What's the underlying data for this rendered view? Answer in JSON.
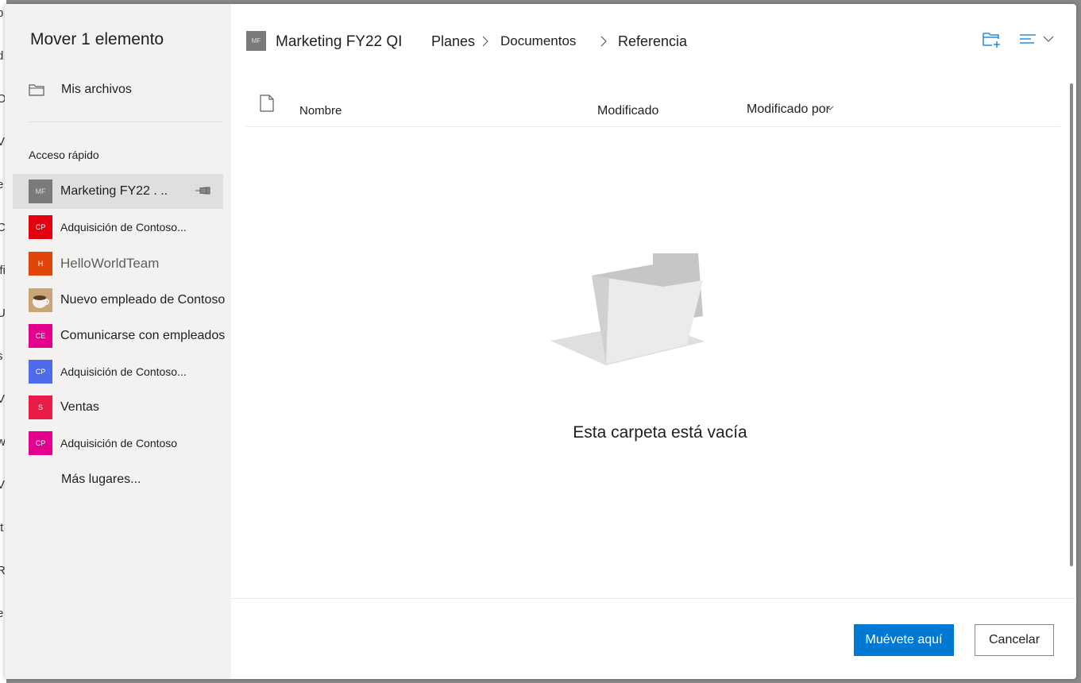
{
  "background_fragments": [
    "p",
    "d",
    "O",
    "V",
    "e",
    "C",
    "ifi",
    "U",
    "s",
    "V",
    "w",
    "V",
    "It",
    "R",
    "e"
  ],
  "dialog": {
    "title": "Mover 1 elemento"
  },
  "sidebar": {
    "my_files_label": "Mis archivos",
    "quick_access_label": "Acceso rápido",
    "items": [
      {
        "tile": "MF",
        "label": "Marketing FY22 .",
        "dots": "..",
        "color": "#7a7a7a"
      },
      {
        "tile": "CP",
        "label": "Adquisición de Contoso...",
        "color": "#e3000f"
      },
      {
        "tile": "H",
        "label": "HelloWorldTeam",
        "color": "#e2450b"
      },
      {
        "tile": "",
        "label": "Nuevo empleado de Contoso",
        "color": "#c9a47a"
      },
      {
        "tile": "CE",
        "label": "Comunicarse con empleados",
        "color": "#e3008c"
      },
      {
        "tile": "CP",
        "label": "Adquisición de Contoso...",
        "color": "#4f6bed"
      },
      {
        "tile": "S",
        "label": "Ventas",
        "color": "#e81c47"
      },
      {
        "tile": "CP",
        "label": "Adquisición de Contoso",
        "color": "#e3008c"
      }
    ],
    "more_places": "Más lugares..."
  },
  "breadcrumb": {
    "site_tile": "MF",
    "site": "Marketing FY22 QI",
    "items": [
      "Planes",
      "Documentos",
      "Referencia"
    ]
  },
  "columns": {
    "name": "Nombre",
    "modified": "Modificado",
    "modified_by": "Modificado por"
  },
  "empty_state": "Esta carpeta está vacía",
  "footer": {
    "move_label": "Muévete aquí",
    "cancel_label": "Cancelar"
  },
  "colors": {
    "accent": "#0078d4",
    "sidebar_bg": "#f3f2f1",
    "selected_bg": "#e1dfdd"
  }
}
